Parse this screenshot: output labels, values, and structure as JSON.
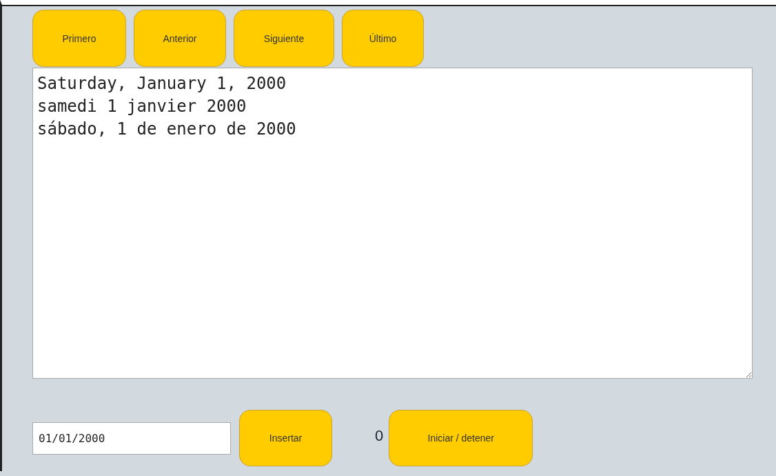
{
  "nav_buttons": [
    "Primero",
    "Anterior",
    "Siguiente",
    "Último"
  ],
  "text_area": {
    "lines": [
      "Saturday, January 1, 2000",
      "samedi 1 janvier 2000",
      "sábado, 1 de enero de 2000"
    ]
  },
  "date_field": {
    "value": "01/01/2000"
  },
  "insert_button": "Insertar",
  "counter": "0",
  "toggle_button": "Iniciar / detener"
}
